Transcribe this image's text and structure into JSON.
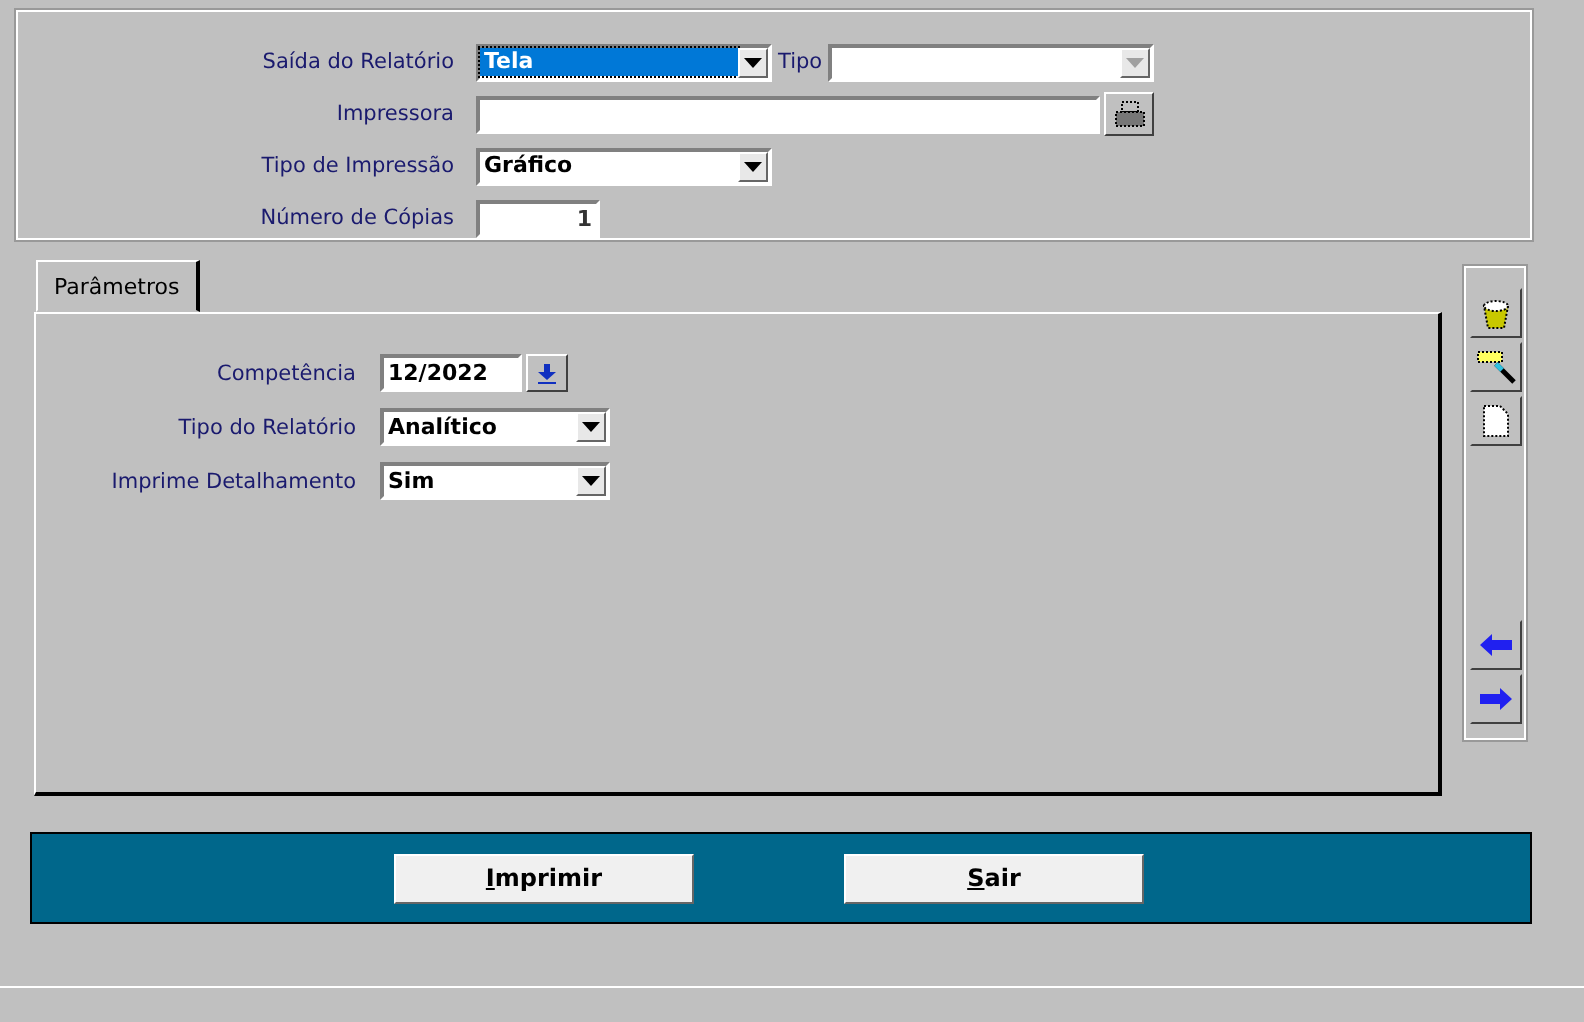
{
  "output_fields": [
    {
      "kind": "select",
      "label": "Saída do Relatório",
      "value": "Tela",
      "focused": true,
      "extra_label": "Tipo",
      "extra_disabled": true
    },
    {
      "kind": "printer",
      "label": "Impressora"
    },
    {
      "kind": "select",
      "label": "Tipo de Impressão",
      "value": "Gráfico",
      "focused": false
    },
    {
      "kind": "number",
      "label": "Número de Cópias",
      "value": "1"
    }
  ],
  "tabs": [
    {
      "label": "Parâmetros",
      "selected": true
    }
  ],
  "parameters": [
    {
      "kind": "date",
      "label": "Competência",
      "value": "12/2022"
    },
    {
      "kind": "select",
      "label": "Tipo do Relatório",
      "value": "Analítico"
    },
    {
      "kind": "select",
      "label": "Imprime Detalhamento",
      "value": "Sim"
    }
  ],
  "buttons": [
    {
      "mnemonic": "I",
      "rest": "mprimir"
    },
    {
      "mnemonic": "S",
      "rest": "air"
    }
  ]
}
